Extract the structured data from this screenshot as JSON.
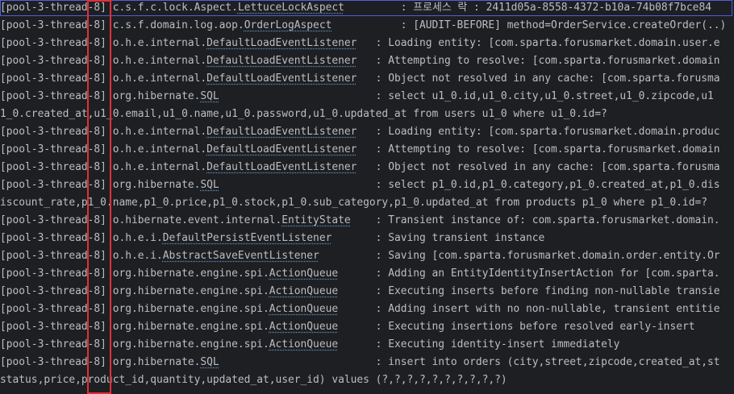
{
  "console": {
    "lines": [
      {
        "thread": "[pool-3-thread-8]",
        "pkg": "c.s.f.c.lock.Aspect.",
        "cls": "LettuceLockAspect",
        "pad": "        ",
        "msg": " : 프로세스 락 : 2411d05a-8558-4372-b10a-74b08f7bce84"
      },
      {
        "thread": "[pool-3-thread-8]",
        "pkg": "c.s.f.domain.log.aop.",
        "cls": "OrderLogAspect",
        "pad": "          ",
        "msg": " : [AUDIT-BEFORE] method=OrderService.createOrder(..)"
      },
      {
        "thread": "[pool-3-thread-8]",
        "pkg": "o.h.e.internal.",
        "cls": "DefaultLoadEventListener",
        "pad": "  ",
        "msg": " : Loading entity: [com.sparta.forusmarket.domain.user.e"
      },
      {
        "thread": "[pool-3-thread-8]",
        "pkg": "o.h.e.internal.",
        "cls": "DefaultLoadEventListener",
        "pad": "  ",
        "msg": " : Attempting to resolve: [com.sparta.forusmarket.domain"
      },
      {
        "thread": "[pool-3-thread-8]",
        "pkg": "o.h.e.internal.",
        "cls": "DefaultLoadEventListener",
        "pad": "  ",
        "msg": " : Object not resolved in any cache: [com.sparta.forusma"
      },
      {
        "thread": "[pool-3-thread-8]",
        "pkg": "org.hibernate.",
        "cls": "SQL",
        "pad": "                        ",
        "msg": " : select u1_0.id,u1_0.city,u1_0.street,u1_0.zipcode,u1"
      },
      {
        "cont": "1_0.created_at,u1_0.email,u1_0.name,u1_0.password,u1_0.updated_at from users u1_0 where u1_0.id=?"
      },
      {
        "thread": "[pool-3-thread-8]",
        "pkg": "o.h.e.internal.",
        "cls": "DefaultLoadEventListener",
        "pad": "  ",
        "msg": " : Loading entity: [com.sparta.forusmarket.domain.produc"
      },
      {
        "thread": "[pool-3-thread-8]",
        "pkg": "o.h.e.internal.",
        "cls": "DefaultLoadEventListener",
        "pad": "  ",
        "msg": " : Attempting to resolve: [com.sparta.forusmarket.domain"
      },
      {
        "thread": "[pool-3-thread-8]",
        "pkg": "o.h.e.internal.",
        "cls": "DefaultLoadEventListener",
        "pad": "  ",
        "msg": " : Object not resolved in any cache: [com.sparta.forusma"
      },
      {
        "thread": "[pool-3-thread-8]",
        "pkg": "org.hibernate.",
        "cls": "SQL",
        "pad": "                        ",
        "msg": " : select p1_0.id,p1_0.category,p1_0.created_at,p1_0.dis"
      },
      {
        "cont": "iscount_rate,p1_0.name,p1_0.price,p1_0.stock,p1_0.sub_category,p1_0.updated_at from products p1_0 where p1_0.id=?"
      },
      {
        "thread": "[pool-3-thread-8]",
        "pkg": "o.hibernate.event.internal.",
        "cls": "EntityState",
        "pad": "   ",
        "msg": " : Transient instance of: com.sparta.forusmarket.domain."
      },
      {
        "thread": "[pool-3-thread-8]",
        "pkg": "o.h.e.i.",
        "cls": "DefaultPersistEventListener",
        "pad": "      ",
        "msg": " : Saving transient instance"
      },
      {
        "thread": "[pool-3-thread-8]",
        "pkg": "o.h.e.i.",
        "cls": "AbstractSaveEventListener",
        "pad": "        ",
        "msg": " : Saving [com.sparta.forusmarket.domain.order.entity.Or"
      },
      {
        "thread": "[pool-3-thread-8]",
        "pkg": "org.hibernate.engine.spi.",
        "cls": "ActionQueue",
        "pad": "     ",
        "msg": " : Adding an EntityIdentityInsertAction for [com.sparta."
      },
      {
        "thread": "[pool-3-thread-8]",
        "pkg": "org.hibernate.engine.spi.",
        "cls": "ActionQueue",
        "pad": "     ",
        "msg": " : Executing inserts before finding non-nullable transie"
      },
      {
        "thread": "[pool-3-thread-8]",
        "pkg": "org.hibernate.engine.spi.",
        "cls": "ActionQueue",
        "pad": "     ",
        "msg": " : Adding insert with no non-nullable, transient entitie"
      },
      {
        "thread": "[pool-3-thread-8]",
        "pkg": "org.hibernate.engine.spi.",
        "cls": "ActionQueue",
        "pad": "     ",
        "msg": " : Executing insertions before resolved early-insert"
      },
      {
        "thread": "[pool-3-thread-8]",
        "pkg": "org.hibernate.engine.spi.",
        "cls": "ActionQueue",
        "pad": "     ",
        "msg": " : Executing identity-insert immediately"
      },
      {
        "thread": "[pool-3-thread-8]",
        "pkg": "org.hibernate.",
        "cls": "SQL",
        "pad": "                        ",
        "msg": " : insert into orders (city,street,zipcode,created_at,st"
      },
      {
        "cont": "status,price,product_id,quantity,updated_at,user_id) values (?,?,?,?,?,?,?,?,?,?)"
      }
    ]
  }
}
